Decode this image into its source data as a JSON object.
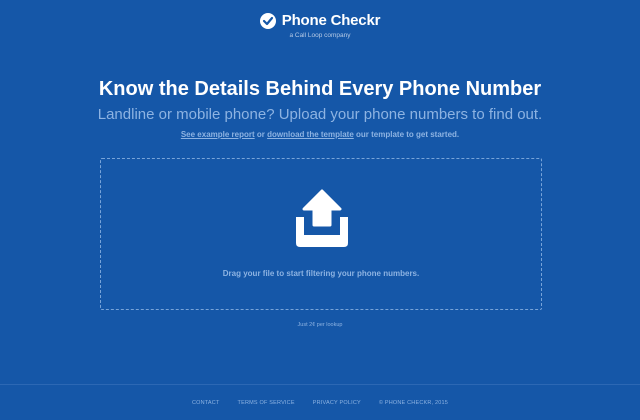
{
  "brand": {
    "name": "Phone Checkr",
    "tagline": "a Call Loop company"
  },
  "hero": {
    "headline": "Know the Details Behind Every Phone Number",
    "subheadline": "Landline or mobile phone? Upload your phone numbers to find out.",
    "hint": {
      "link1": "See example report",
      "or": " or ",
      "link2": "download the template",
      "rest": " our template to get started."
    }
  },
  "dropzone": {
    "icon": "upload-icon",
    "text": "Drag your file to start filtering your phone numbers."
  },
  "pricing": {
    "text": "Just 2¢ per lookup"
  },
  "footer": {
    "links": [
      "CONTACT",
      "TERMS OF SERVICE",
      "PRIVACY POLICY"
    ],
    "copyright": "© PHONE CHECKR, 2015"
  },
  "colors": {
    "background": "#1557a8",
    "muted_text": "#8db3e2",
    "dashed_border": "#78a4d9"
  }
}
